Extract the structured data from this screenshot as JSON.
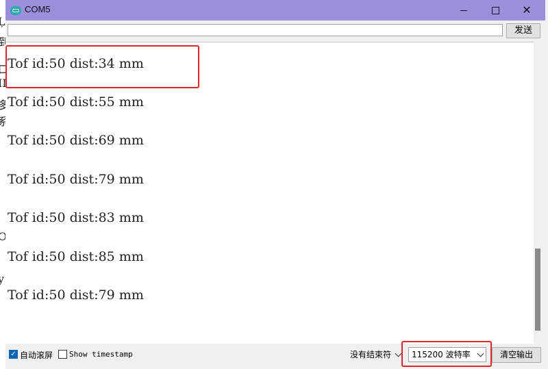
{
  "window": {
    "title": "COM5"
  },
  "background_fragments": [
    "Ļ",
    "到",
    "口",
    "II",
    "多",
    "系",
    "O",
    "y"
  ],
  "send": {
    "input_value": "",
    "button_label": "发送"
  },
  "output": {
    "lines": [
      "Tof id:50 dist:34 mm",
      "Tof id:50 dist:55 mm",
      "Tof id:50 dist:69 mm",
      "Tof id:50 dist:79 mm",
      "Tof id:50 dist:83 mm",
      "Tof id:50 dist:85 mm",
      "Tof id:50 dist:79 mm"
    ]
  },
  "status": {
    "autoscroll_label": "自动滚屏",
    "autoscroll_checked": true,
    "timestamp_label": "Show timestamp",
    "timestamp_checked": false,
    "line_ending": "没有结束符",
    "baud_rate": "115200 波特率",
    "clear_button": "清空输出"
  },
  "colors": {
    "titlebar": "#9b8fdc",
    "highlight": "#e0262b"
  }
}
